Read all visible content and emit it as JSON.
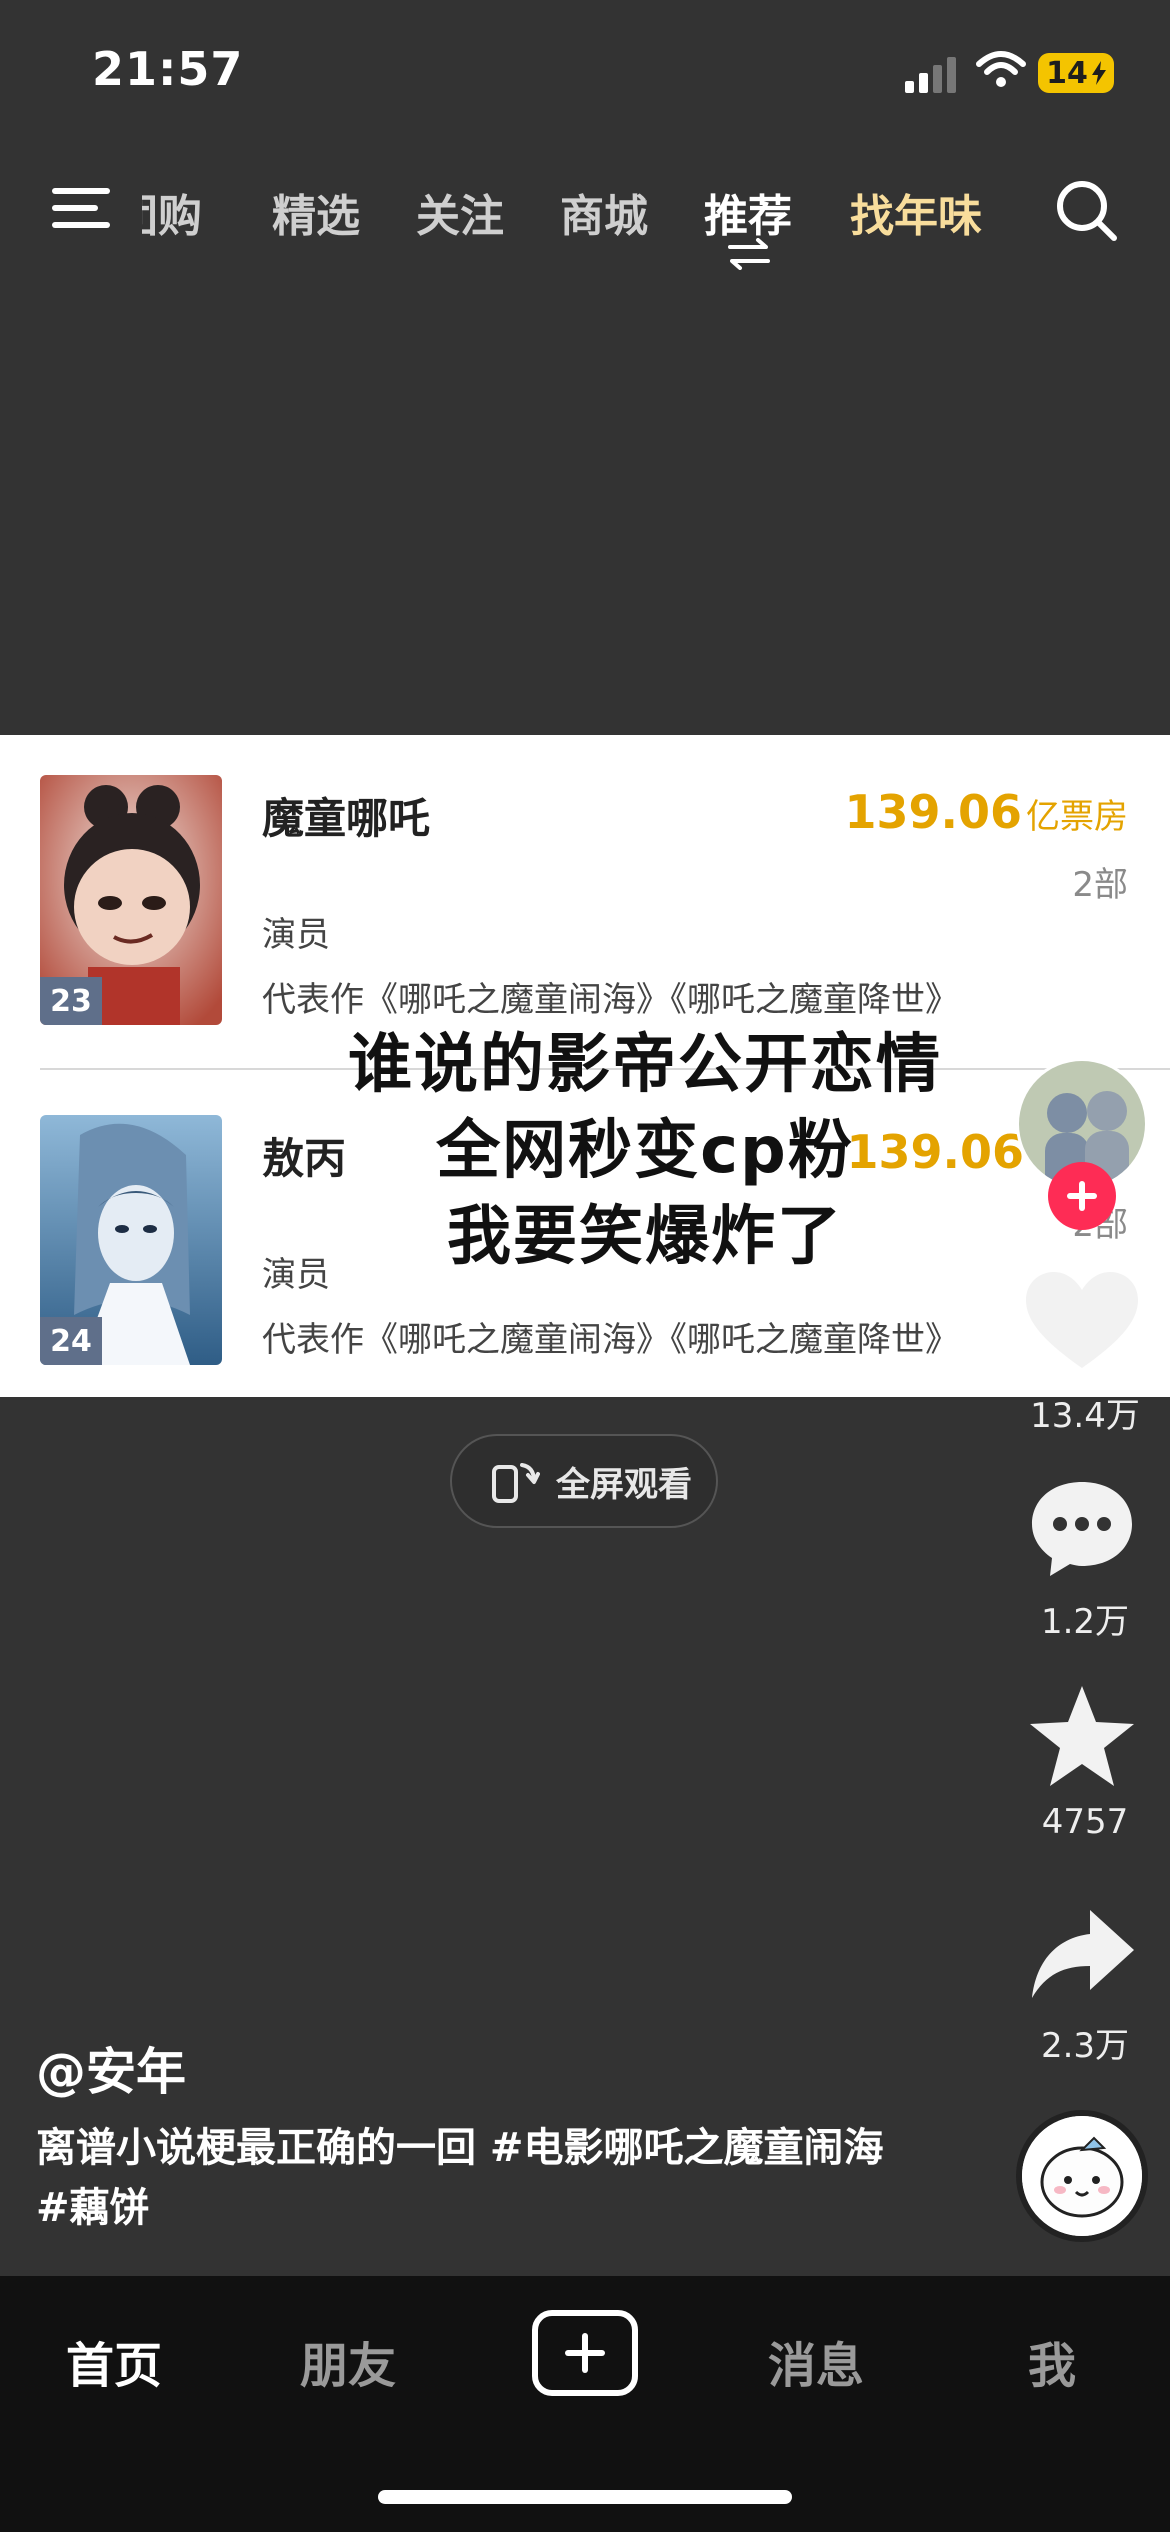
{
  "status": {
    "time": "21:57",
    "battery": "14"
  },
  "nav": {
    "tabs": [
      "团购",
      "精选",
      "关注",
      "商城",
      "推荐",
      "找年味"
    ],
    "active_tab": "推荐",
    "special_tab": "找年味"
  },
  "card": {
    "rows": [
      {
        "rank": "23",
        "name": "魔童哪吒",
        "role": "演员",
        "works": "代表作《哪吒之魔童闹海》《哪吒之魔童降世》",
        "box_office_value": "139.06",
        "box_office_unit": "亿票房",
        "count": "2部"
      },
      {
        "rank": "24",
        "name": "敖丙",
        "role": "演员",
        "works": "代表作《哪吒之魔童闹海》《哪吒之魔童降世》",
        "box_office_value": "139.06",
        "box_office_unit": "",
        "count": "2部"
      }
    ]
  },
  "caption": {
    "line1": "谁说的影帝公开恋情",
    "line2": "全网秒变cp粉",
    "line3": "我要笑爆炸了"
  },
  "fullscreen_label": "全屏观看",
  "actions": {
    "likes": "13.4万",
    "comments": "1.2万",
    "favorites": "4757",
    "shares": "2.3万"
  },
  "post": {
    "author": "@安年",
    "description": "离谱小说梗最正确的一回 #电影哪吒之魔童闹海 #藕饼"
  },
  "bottom_nav": {
    "home": "首页",
    "friends": "朋友",
    "messages": "消息",
    "me": "我"
  },
  "colors": {
    "accent_gold": "#e4a300",
    "tab_special": "#f8dd9c",
    "follow_red": "#fe2c55",
    "background": "#333333"
  },
  "icons": [
    "menu-icon",
    "swap-icon",
    "search-icon",
    "rotate-screen-icon",
    "heart-icon",
    "comment-icon",
    "star-icon",
    "share-icon",
    "plus-icon"
  ]
}
